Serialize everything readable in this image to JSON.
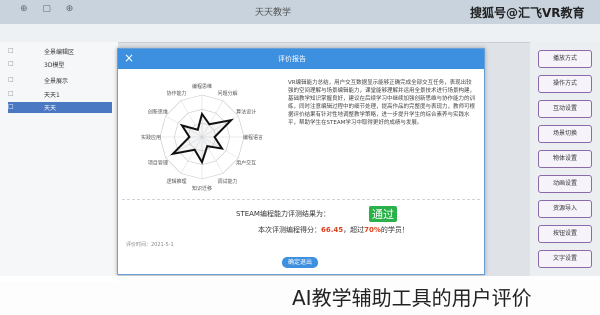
{
  "app": {
    "title": "天天教学",
    "window_icons": "⊕ ▢ ⊕"
  },
  "watermark": "搜狐号@汇飞VR教育",
  "tree": [
    {
      "icon": "□",
      "label": "全景编辑区"
    },
    {
      "icon": "□",
      "label": "3D模型"
    },
    {
      "icon": "□",
      "label": "全景展示"
    },
    {
      "icon": "□",
      "label": "天天1"
    },
    {
      "icon": "□",
      "label": "天天"
    }
  ],
  "side_buttons": [
    "播放方式",
    "操作方式",
    "互动设置",
    "场景切换",
    "物体设置",
    "动画设置",
    "资源导入",
    "按钮设置",
    "文字设置",
    "声音设置"
  ],
  "modal": {
    "title": "评价报告",
    "close_icon": "×",
    "paragraph": "VR编辑能力总结，用户交互数据显示能够正确完成全部交互任务，表现出较强的空间理解与场景编辑能力，课堂能够理解并运用全景技术进行场景构建，基础教学知识掌握良好，建议在后续学习中继续加强创新思维与协作能力的训练，同时注意编辑过程中的细节处理，提高作品的完整度与表现力，教师可根据评价结果有针对性地调整教学策略，进一步提升学生的综合素养与实践水平，帮助学生在STEAM学习中取得更好的成绩与发展。",
    "result_prefix": "STEAM编程能力评测结果为：",
    "result_badge": "通过",
    "score_prefix": "本次评测编程得分：",
    "score_value": "66.45",
    "score_mid": "，超过",
    "score_pct": "70%",
    "score_suffix": "的学员！",
    "meta": "评价时间：2021-5-1",
    "confirm_label": "确定退出"
  },
  "radar": {
    "axes": [
      "编程思维",
      "问题分解",
      "算法设计",
      "编程语言",
      "用户交互",
      "调试能力",
      "知识迁移",
      "逻辑推理",
      "项目管理",
      "实践应用",
      "创新思维",
      "协作能力"
    ],
    "values": [
      0.55,
      0.35,
      0.8,
      0.3,
      0.55,
      0.25,
      0.6,
      0.35,
      0.8,
      0.3,
      0.55,
      0.2
    ]
  },
  "caption": "AI教学辅助工具的用户评价"
}
